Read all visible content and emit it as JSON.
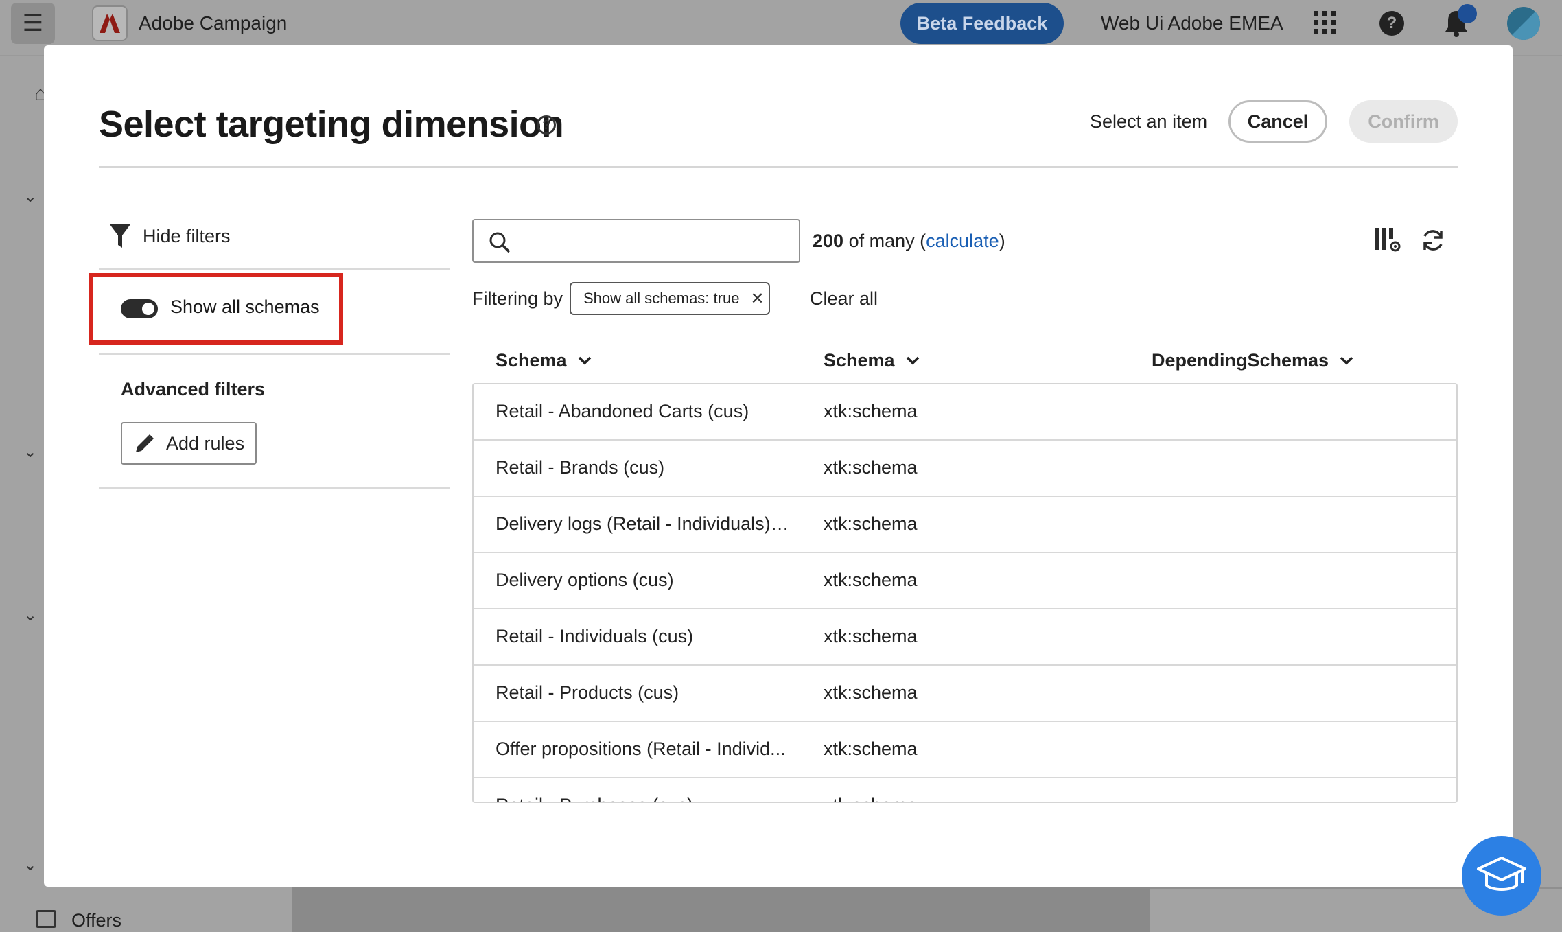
{
  "topbar": {
    "app_name": "Adobe Campaign",
    "beta_feedback": "Beta Feedback",
    "org_name": "Web Ui Adobe EMEA"
  },
  "sidebar": {
    "offers_label": "Offers"
  },
  "modal": {
    "title": "Select targeting dimension",
    "select_item": "Select an item",
    "cancel_label": "Cancel",
    "confirm_label": "Confirm"
  },
  "filters": {
    "hide_filters": "Hide filters",
    "show_all_schemas": "Show all schemas",
    "show_all_schemas_on": true,
    "advanced_filters": "Advanced filters",
    "add_rules": "Add rules"
  },
  "list": {
    "search_placeholder": "",
    "count": "200",
    "count_suffix": " of many (",
    "calculate": "calculate",
    "count_close": ")",
    "filtering_by": "Filtering by",
    "active_filter": "Show all schemas: true",
    "clear_all": "Clear all",
    "columns": [
      "Schema",
      "Schema",
      "DependingSchemas"
    ],
    "rows": [
      {
        "label": "Retail - Abandoned Carts (cus)",
        "schema": "xtk:schema"
      },
      {
        "label": "Retail - Brands (cus)",
        "schema": "xtk:schema"
      },
      {
        "label": "Delivery logs (Retail - Individuals) ...",
        "schema": "xtk:schema"
      },
      {
        "label": "Delivery options (cus)",
        "schema": "xtk:schema"
      },
      {
        "label": "Retail - Individuals (cus)",
        "schema": "xtk:schema"
      },
      {
        "label": "Retail - Products (cus)",
        "schema": "xtk:schema"
      },
      {
        "label": "Offer propositions (Retail - Individ...",
        "schema": "xtk:schema"
      },
      {
        "label": "Retail - Purchases (cus)",
        "schema": "xtk:schema"
      }
    ]
  },
  "colors": {
    "accent": "#1a5fb4",
    "highlight": "#d7261e",
    "edu_button": "#2c80e4"
  }
}
